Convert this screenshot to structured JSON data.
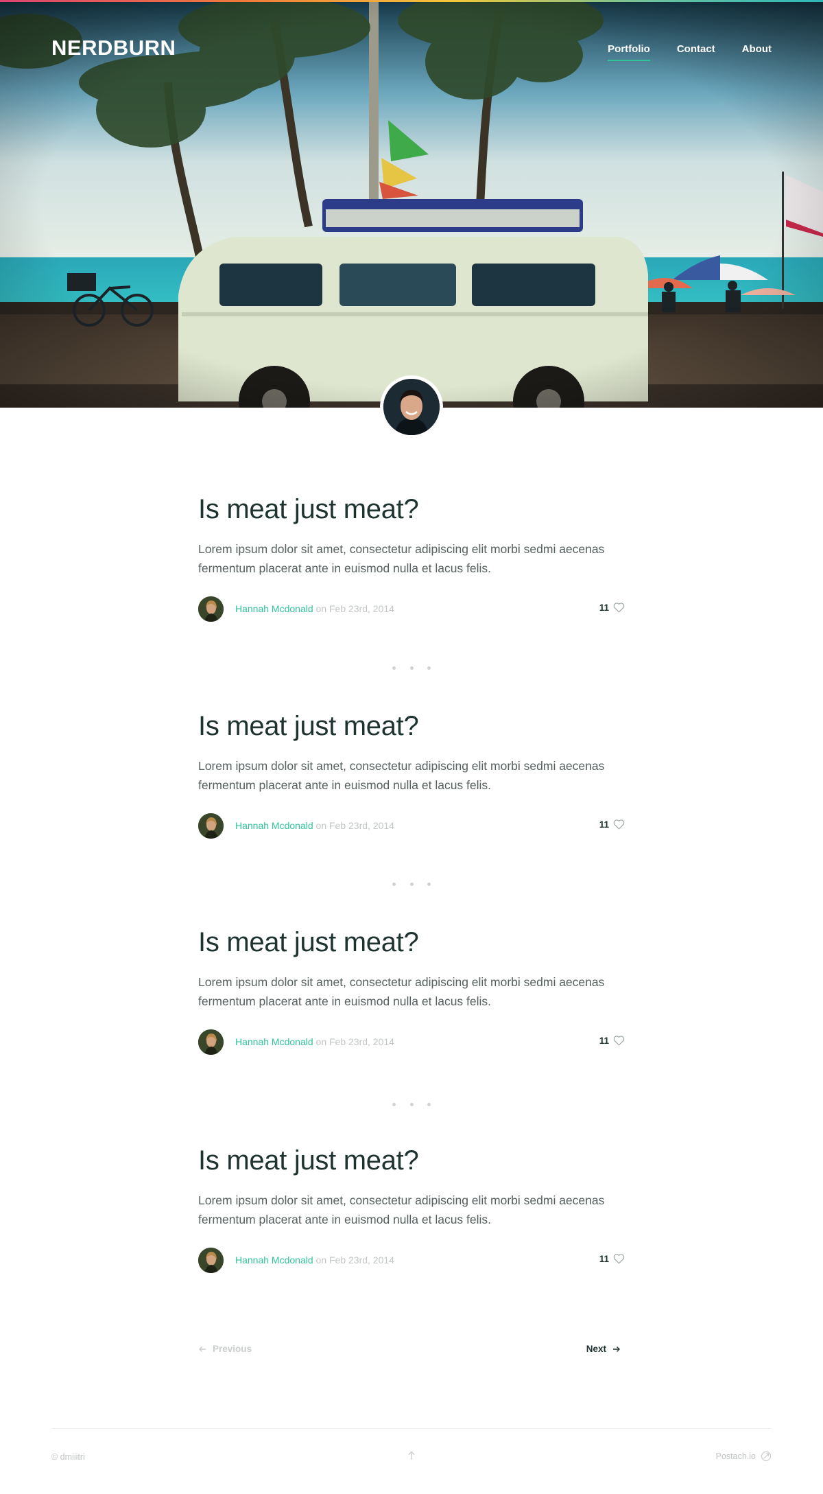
{
  "header": {
    "brand": "NERDBURN",
    "nav": [
      {
        "label": "Portfolio",
        "active": true
      },
      {
        "label": "Contact",
        "active": false
      },
      {
        "label": "About",
        "active": false
      }
    ]
  },
  "posts": [
    {
      "title": "Is meat just meat?",
      "excerpt": "Lorem ipsum dolor sit amet, consectetur adipiscing elit morbi sedmi aecenas fermentum placerat ante in euismod nulla et lacus felis.",
      "author": "Hannah Mcdonald",
      "date": "on Feb 23rd, 2014",
      "likes": "11"
    },
    {
      "title": "Is meat just meat?",
      "excerpt": "Lorem ipsum dolor sit amet, consectetur adipiscing elit morbi sedmi aecenas fermentum placerat ante in euismod nulla et lacus felis.",
      "author": "Hannah Mcdonald",
      "date": "on Feb 23rd, 2014",
      "likes": "11"
    },
    {
      "title": "Is meat just meat?",
      "excerpt": "Lorem ipsum dolor sit amet, consectetur adipiscing elit morbi sedmi aecenas fermentum placerat ante in euismod nulla et lacus felis.",
      "author": "Hannah Mcdonald",
      "date": "on Feb 23rd, 2014",
      "likes": "11"
    },
    {
      "title": "Is meat just meat?",
      "excerpt": "Lorem ipsum dolor sit amet, consectetur adipiscing elit morbi sedmi aecenas fermentum placerat ante in euismod nulla et lacus felis.",
      "author": "Hannah Mcdonald",
      "date": "on Feb 23rd, 2014",
      "likes": "11"
    }
  ],
  "pagination": {
    "previous": "Previous",
    "next": "Next"
  },
  "footer": {
    "copyright": "© dmiiitri",
    "powered_by": "Postach.io"
  },
  "icons": {
    "like": "heart-icon",
    "previous": "arrow-left-icon",
    "next": "arrow-right-icon",
    "to_top": "arrow-up-icon",
    "powered": "postachio-logo-icon"
  },
  "colors": {
    "accent": "#2fc39a",
    "title": "#1e3330",
    "text": "#56605f",
    "muted": "#c2c6c5"
  }
}
